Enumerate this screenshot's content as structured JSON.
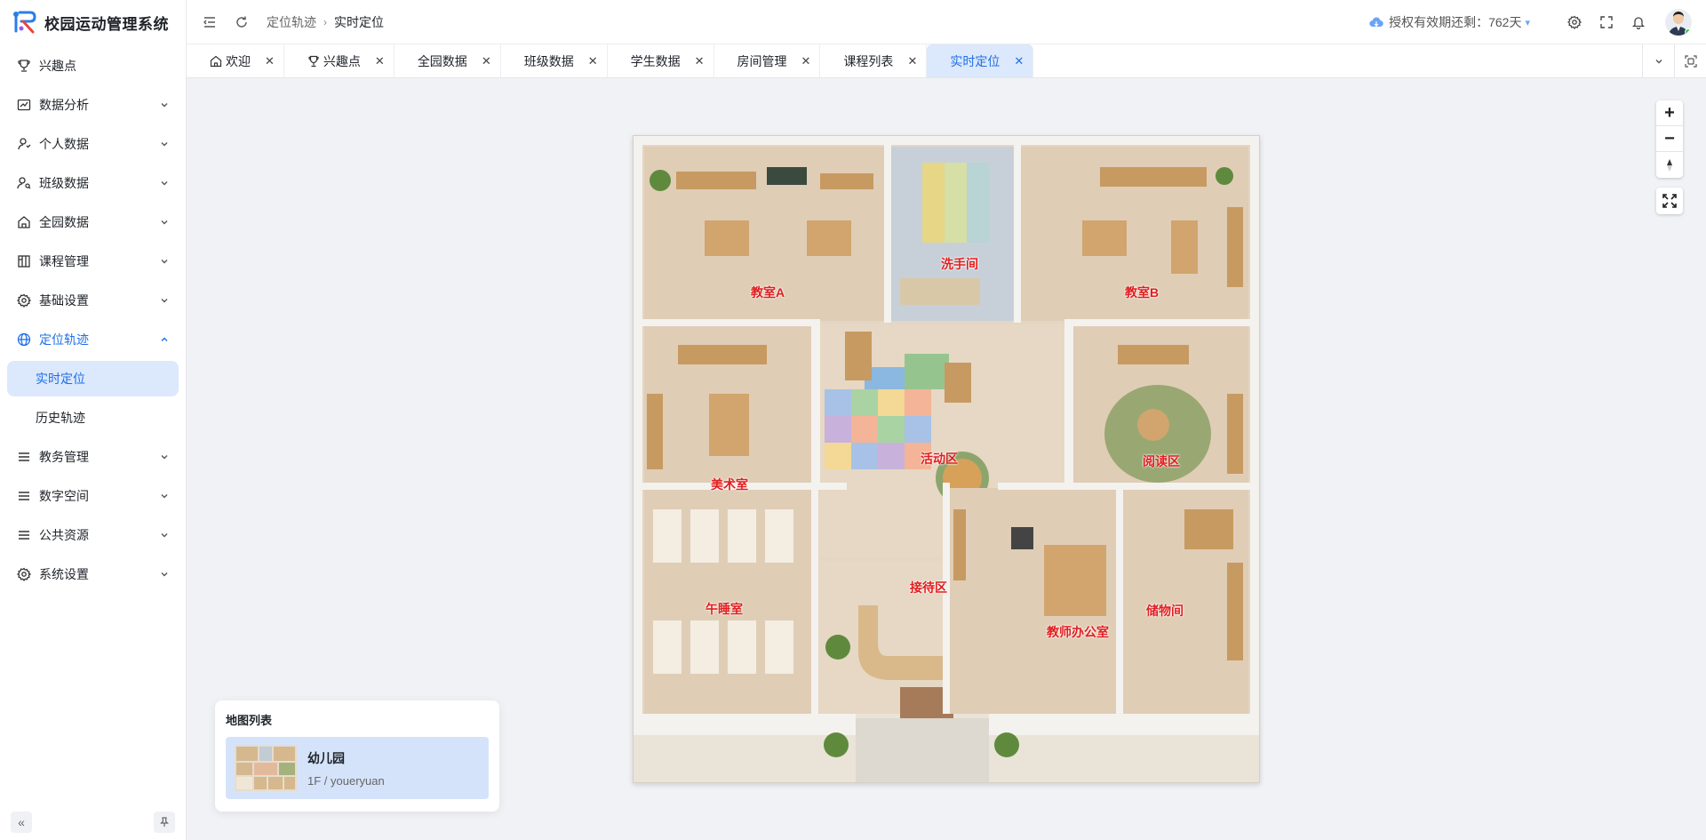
{
  "app": {
    "title": "校园运动管理系统"
  },
  "sidebar": {
    "items": [
      {
        "label": "兴趣点",
        "icon": "trophy-icon"
      },
      {
        "label": "数据分析",
        "icon": "chart-icon"
      },
      {
        "label": "个人数据",
        "icon": "user-icon"
      },
      {
        "label": "班级数据",
        "icon": "user-search-icon"
      },
      {
        "label": "全园数据",
        "icon": "home-icon"
      },
      {
        "label": "课程管理",
        "icon": "grid-icon"
      },
      {
        "label": "基础设置",
        "icon": "gear-icon"
      },
      {
        "label": "定位轨迹",
        "icon": "globe-icon"
      },
      {
        "label": "教务管理",
        "icon": "list-icon"
      },
      {
        "label": "数字空间",
        "icon": "list-icon"
      },
      {
        "label": "公共资源",
        "icon": "list-icon"
      },
      {
        "label": "系统设置",
        "icon": "gear-icon"
      }
    ],
    "submenu": [
      {
        "label": "实时定位"
      },
      {
        "label": "历史轨迹"
      }
    ]
  },
  "header": {
    "breadcrumb": [
      "定位轨迹",
      "实时定位"
    ],
    "license_text": "授权有效期还剩：762天"
  },
  "tabs": [
    {
      "label": "欢迎",
      "icon": "home-icon"
    },
    {
      "label": "兴趣点",
      "icon": "trophy-icon"
    },
    {
      "label": "全园数据"
    },
    {
      "label": "班级数据"
    },
    {
      "label": "学生数据"
    },
    {
      "label": "房间管理"
    },
    {
      "label": "课程列表"
    },
    {
      "label": "实时定位"
    }
  ],
  "map": {
    "rooms": [
      "教室A",
      "洗手间",
      "教室B",
      "美术室",
      "活动区",
      "阅读区",
      "午睡室",
      "接待区",
      "教师办公室",
      "储物间"
    ]
  },
  "map_list": {
    "title": "地图列表",
    "items": [
      {
        "name": "幼儿园",
        "sub": "1F / youeryuan"
      }
    ]
  },
  "colors": {
    "accent": "#1e6fe8",
    "active_bg": "#dce8fb",
    "room_label": "#e01e1e"
  }
}
